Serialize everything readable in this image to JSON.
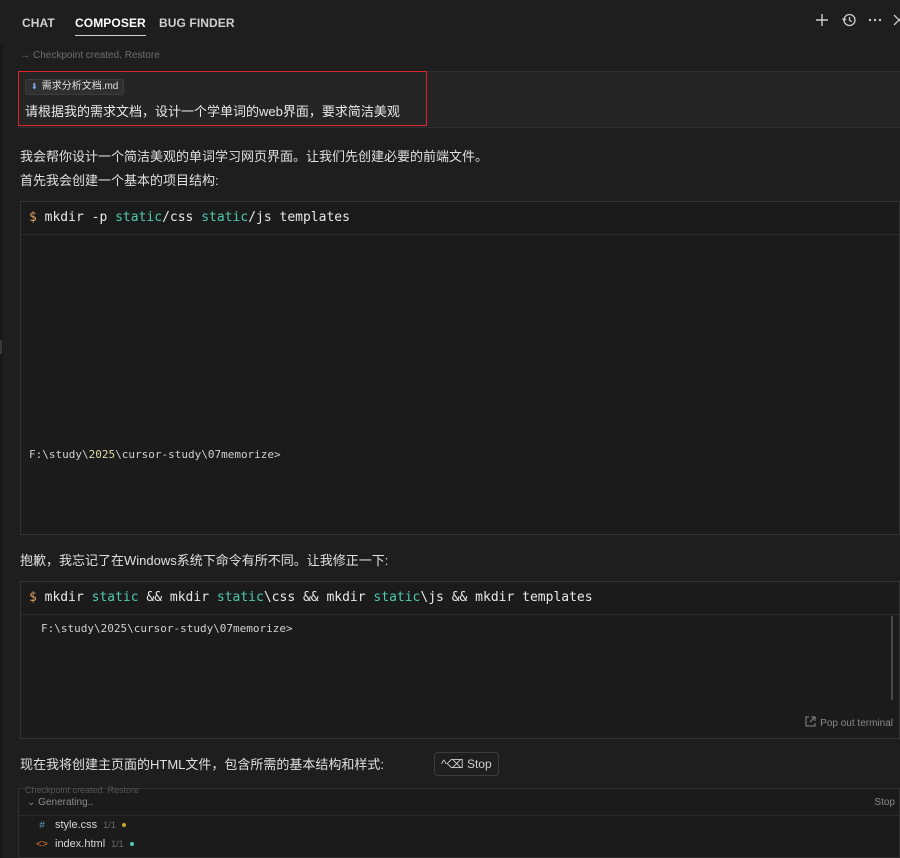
{
  "tabs": [
    {
      "label": "CHAT",
      "active": false
    },
    {
      "label": "COMPOSER",
      "active": true
    },
    {
      "label": "BUG FINDER",
      "active": false
    }
  ],
  "header_icons": [
    "plus-icon",
    "history-icon",
    "more-icon",
    "close-icon"
  ],
  "checkpoint": {
    "text": "Checkpoint created.",
    "restore": "Restore"
  },
  "user_message": {
    "attachment": "需求分析文档.md",
    "text": "请根据我的需求文档，设计一个学单词的web界面，要求简洁美观"
  },
  "assistant": {
    "line1": "我会帮你设计一个简洁美观的单词学习网页界面。让我们先创建必要的前端文件。",
    "line2": "首先我会创建一个基本的项目结构:",
    "line3": "抱歉，我忘记了在Windows系统下命令有所不同。让我修正一下:",
    "line4": "现在我将创建主页面的HTML文件，包含所需的基本结构和样式:"
  },
  "terminal1": {
    "dollar": "$",
    "cmd_parts": [
      "mkdir -p ",
      "static",
      "/css ",
      "static",
      "/js templates"
    ],
    "prompt_parts": [
      "F:\\study\\",
      "2025",
      "\\cursor-study\\07memorize>"
    ]
  },
  "terminal2": {
    "dollar": "$",
    "cmd_parts": [
      "mkdir ",
      "static",
      " && mkdir ",
      "static",
      "\\css && mkdir ",
      "static",
      "\\js && mkdir templates"
    ],
    "prompt": "F:\\study\\2025\\cursor-study\\07memorize>",
    "popout": "Pop out terminal"
  },
  "stop_button": {
    "shortcut": "^⌫",
    "label": "Stop"
  },
  "generating": {
    "checkpoint_partial": "Checkpoint created. Restore",
    "status": "Generating..",
    "stop": "Stop",
    "files": [
      {
        "name": "style.css",
        "count": "1/1",
        "icon": "hash-icon",
        "icon_color": "#519aba",
        "dot_color": "#c5a332"
      },
      {
        "name": "index.html",
        "count": "1/1",
        "icon": "code-icon",
        "icon_color": "#e37933",
        "dot_color": "#4ec9b0"
      }
    ]
  },
  "colors": {
    "accent_highlight": "#d9252b",
    "cyan": "#4ec9b0",
    "yellow": "#dcdcaa"
  }
}
